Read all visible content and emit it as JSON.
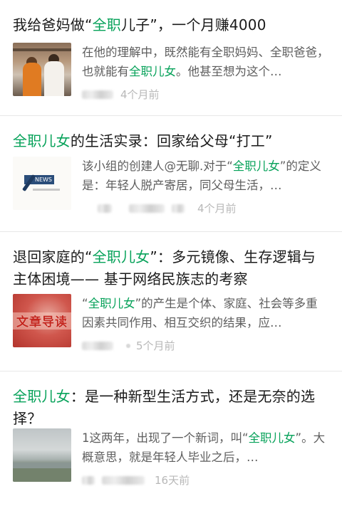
{
  "articles": [
    {
      "title_pre": "我给爸妈做“",
      "title_hl": "全职",
      "title_post": "儿子”，一个月赚4000",
      "snippet_pre": "在他的理解中，既然能有全职妈妈、全职爸爸，也就能有",
      "snippet_hl": "全职儿女",
      "snippet_post": "。他甚至想为这个…",
      "time": "4个月前",
      "thumb_icon": "kitchen-photo"
    },
    {
      "title_pre": "",
      "title_hl": "全职儿女",
      "title_post": "的生活实录：回家给父母“打工”",
      "snippet_pre": "该小组的创建人@无聊.对于“",
      "snippet_hl": "全职儿女",
      "snippet_post": "”的定义是：年轻人脱产寄居，同父母生活，…",
      "time": "4个月前",
      "thumb_icon": "news-logo",
      "thumb_badge": "NEWS"
    },
    {
      "title_pre": "退回家庭的“",
      "title_hl": "全职儿女",
      "title_post": "”：多元镜像、生存逻辑与主体困境—— 基于网络民族志的考察",
      "snippet_pre": "“",
      "snippet_hl": "全职儿女",
      "snippet_post": "”的产生是个体、家庭、社会等多重因素共同作用、相互交织的结果，应…",
      "time": "5个月前",
      "thumb_icon": "red-cover",
      "thumb_text": "文章导读"
    },
    {
      "title_pre": "",
      "title_hl": "全职儿女",
      "title_post": "：是一种新型生活方式，还是无奈的选择？",
      "snippet_pre": "1这两年，出现了一个新词，叫“",
      "snippet_hl": "全职儿女",
      "snippet_post": "”。大概意思，就是年轻人毕业之后，…",
      "time": "16天前",
      "thumb_icon": "lake-photo"
    }
  ],
  "colors": {
    "highlight": "#07a25a",
    "title": "#1a1a1a",
    "snippet": "#5e5e5e",
    "meta": "#b8b8b8"
  }
}
